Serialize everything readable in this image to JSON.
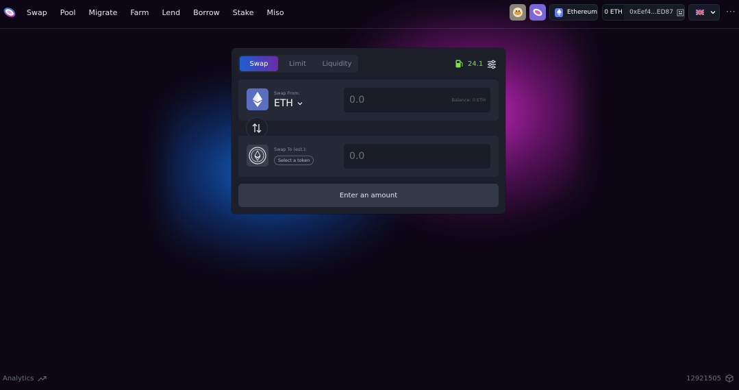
{
  "nav": {
    "items": [
      {
        "label": "Swap"
      },
      {
        "label": "Pool"
      },
      {
        "label": "Migrate"
      },
      {
        "label": "Farm"
      },
      {
        "label": "Lend"
      },
      {
        "label": "Borrow"
      },
      {
        "label": "Stake"
      },
      {
        "label": "Miso"
      }
    ]
  },
  "header": {
    "network_label": "Ethereum",
    "eth_balance": "0 ETH",
    "account_address": "0xEef4...ED87",
    "language_flag": "uk-flag-icon",
    "more_label": "···"
  },
  "swap_card": {
    "tabs": [
      {
        "label": "Swap",
        "active": true
      },
      {
        "label": "Limit",
        "active": false
      },
      {
        "label": "Liquidity",
        "active": false
      }
    ],
    "gas_price": "24.1",
    "from": {
      "label": "Swap From:",
      "token_symbol": "ETH",
      "amount_placeholder": "0.0",
      "balance": "Balance: 0 ETH"
    },
    "to": {
      "label": "Swap To (est.):",
      "select_token_label": "Select a token",
      "amount_placeholder": "0.0"
    },
    "action_button_label": "Enter an amount"
  },
  "footer": {
    "analytics_label": "Analytics",
    "block_number": "12921505"
  },
  "colors": {
    "background": "#0d0715",
    "card": "#1c1f2a",
    "panel": "#252936",
    "gas_green": "#7ee04a",
    "tab_gradient_start": "#1d5fcf",
    "tab_gradient_end": "#6b2aa8"
  }
}
